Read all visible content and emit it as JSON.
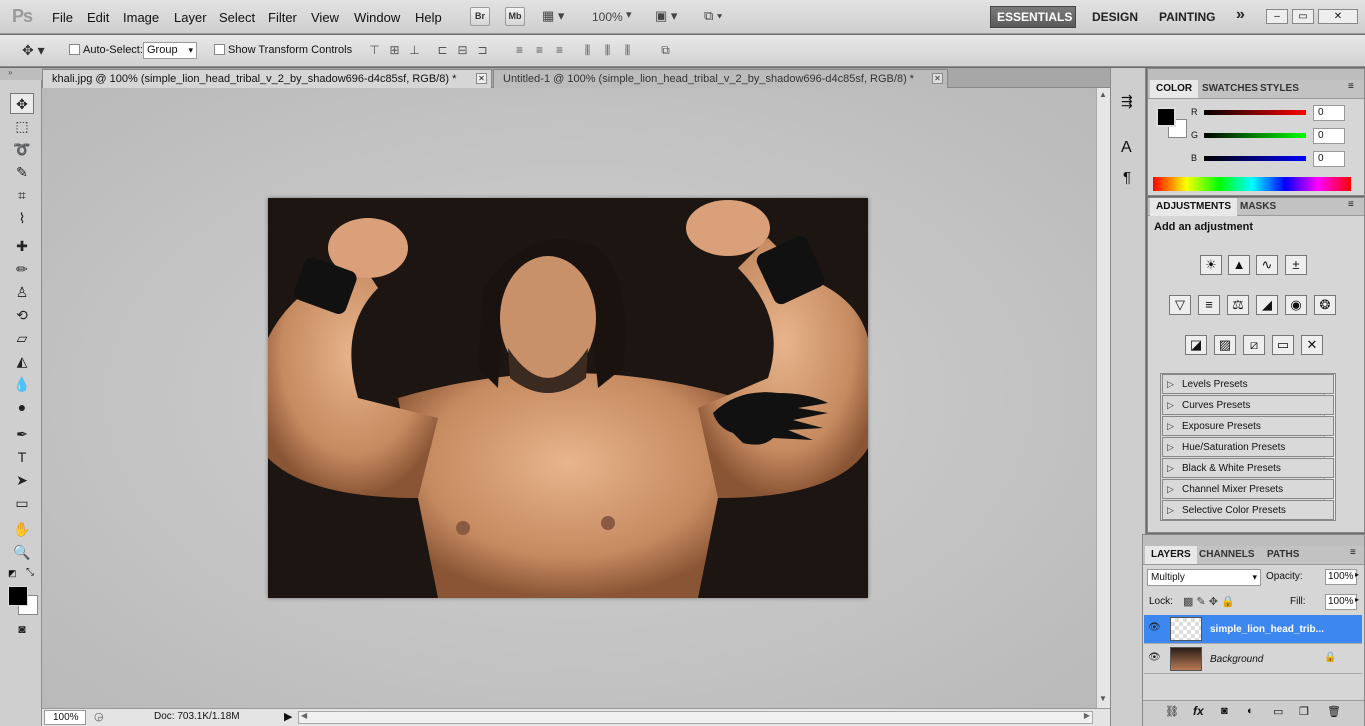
{
  "app": {
    "logo": "Ps"
  },
  "menu": [
    "File",
    "Edit",
    "Image",
    "Layer",
    "Select",
    "Filter",
    "View",
    "Window",
    "Help"
  ],
  "app_bar": {
    "bridge": "Br",
    "minibridge": "Mb",
    "zoom": "100%"
  },
  "workspaces": {
    "essentials": "ESSENTIALS",
    "design": "DESIGN",
    "painting": "PAINTING",
    "more": "»"
  },
  "window_controls": {
    "minimize": "–",
    "restore": "▭",
    "close": "✕"
  },
  "options_bar": {
    "auto_select_label": "Auto-Select:",
    "auto_select_value": "Group",
    "show_transform_label": "Show Transform Controls"
  },
  "tabs": [
    {
      "label": "khali.jpg @ 100% (simple_lion_head_tribal_v_2_by_shadow696-d4c85sf, RGB/8) *",
      "active": true
    },
    {
      "label": "Untitled-1 @ 100% (simple_lion_head_tribal_v_2_by_shadow696-d4c85sf, RGB/8) *",
      "active": false
    }
  ],
  "status": {
    "zoom": "100%",
    "doc": "Doc: 703.1K/1.18M"
  },
  "color_panel": {
    "tabs": [
      "COLOR",
      "SWATCHES",
      "STYLES"
    ],
    "channels": [
      {
        "label": "R",
        "value": "0"
      },
      {
        "label": "G",
        "value": "0"
      },
      {
        "label": "B",
        "value": "0"
      }
    ]
  },
  "adjustments_panel": {
    "tabs": [
      "ADJUSTMENTS",
      "MASKS"
    ],
    "heading": "Add an adjustment",
    "presets": [
      "Levels Presets",
      "Curves Presets",
      "Exposure Presets",
      "Hue/Saturation Presets",
      "Black & White Presets",
      "Channel Mixer Presets",
      "Selective Color Presets"
    ]
  },
  "layers_panel": {
    "tabs": [
      "LAYERS",
      "CHANNELS",
      "PATHS"
    ],
    "blend_mode": "Multiply",
    "opacity_label": "Opacity:",
    "opacity": "100%",
    "lock_label": "Lock:",
    "fill_label": "Fill:",
    "fill": "100%",
    "layers": [
      {
        "name": "simple_lion_head_trib...",
        "selected": true
      },
      {
        "name": "Background",
        "selected": false
      }
    ]
  }
}
